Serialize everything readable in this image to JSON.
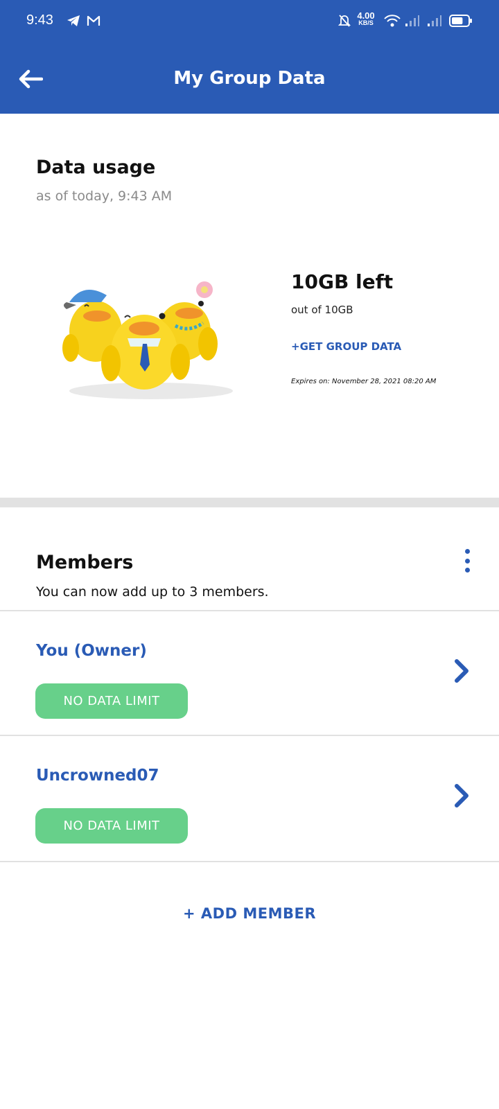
{
  "status_bar": {
    "time": "9:43",
    "speed_value": "4.00",
    "speed_unit": "KB/S",
    "icons": [
      "telegram-icon",
      "gmail-icon",
      "bell-off-icon",
      "wifi-icon",
      "signal-icon",
      "signal-icon",
      "battery-icon"
    ],
    "battery_level": 0.7
  },
  "header": {
    "title": "My Group Data",
    "background_color": "#2a5bb5"
  },
  "usage": {
    "title": "Data usage",
    "subtitle": "as of today, 9:43 AM",
    "left_amount": "10GB left",
    "out_of": "out of 10GB",
    "get_data_label": "+GET GROUP DATA",
    "expires": "Expires on: November 28, 2021 08:20 AM"
  },
  "members": {
    "title": "Members",
    "subtitle": "You can now add up to 3 members.",
    "list": [
      {
        "name": "You (Owner)",
        "limit": "NO DATA LIMIT"
      },
      {
        "name": "Uncrowned07",
        "limit": "NO DATA LIMIT"
      }
    ],
    "add_label": "+ ADD MEMBER"
  },
  "colors": {
    "accent": "#2a5bb5",
    "pill": "#67d08a",
    "duck": "#f7d21e"
  }
}
